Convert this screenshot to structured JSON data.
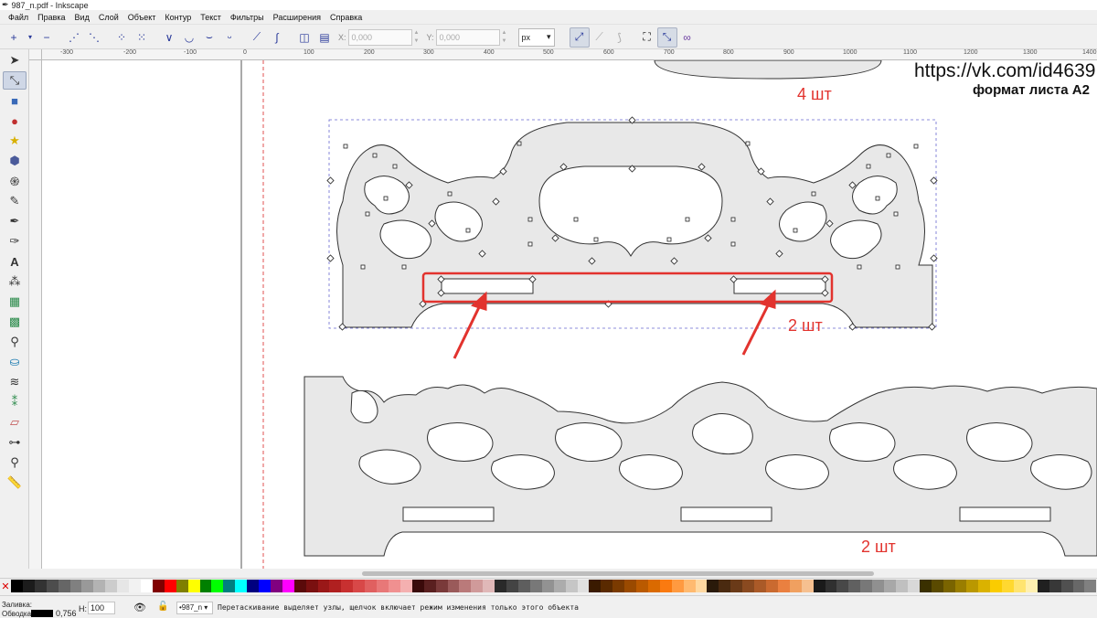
{
  "window": {
    "title": "987_n.pdf - Inkscape"
  },
  "menu": [
    "Файл",
    "Правка",
    "Вид",
    "Слой",
    "Объект",
    "Контур",
    "Текст",
    "Фильтры",
    "Расширения",
    "Справка"
  ],
  "toolbar": {
    "x_label": "X:",
    "x_value": "0,000",
    "y_label": "Y:",
    "y_value": "0,000",
    "unit": "px"
  },
  "ruler": {
    "labels": [
      "-300",
      "-200",
      "-100",
      "0",
      "100",
      "200",
      "300",
      "400",
      "500",
      "600",
      "700",
      "800",
      "900",
      "1000",
      "1100",
      "1200",
      "1300",
      "1400"
    ]
  },
  "canvas": {
    "url_text": "https://vk.com/id4639",
    "sheet_format": "формат листа А2",
    "qty_top": "4 шт",
    "qty_middle": "2 шт",
    "qty_bottom": "2 шт",
    "accent_color": "#e2332e",
    "shape_fill": "#e8e8e8",
    "shape_stroke": "#333333"
  },
  "palette": {
    "colors": [
      "#000000",
      "#1c1c1c",
      "#333333",
      "#4d4d4d",
      "#666666",
      "#808080",
      "#999999",
      "#b3b3b3",
      "#cccccc",
      "#e6e6e6",
      "#f2f2f2",
      "#ffffff",
      "#800000",
      "#ff0000",
      "#808000",
      "#ffff00",
      "#008000",
      "#00ff00",
      "#008080",
      "#00ffff",
      "#000080",
      "#0000ff",
      "#800080",
      "#ff00ff",
      "#5a0a0a",
      "#7a1010",
      "#9a1818",
      "#b02020",
      "#c83030",
      "#d84848",
      "#e06060",
      "#e87878",
      "#f09090",
      "#f4b0b0",
      "#3a0a0a",
      "#5a2020",
      "#7a3a3a",
      "#9a5a5a",
      "#ba7a7a",
      "#d09a9a",
      "#e0b8b8",
      "#2a2a2a",
      "#444444",
      "#5e5e5e",
      "#787878",
      "#929292",
      "#acacac",
      "#c6c6c6",
      "#e0e0e0",
      "#3a1a00",
      "#5a2a00",
      "#7a3a00",
      "#9a4a00",
      "#ba5a00",
      "#da6a00",
      "#fa7a10",
      "#ff9a40",
      "#ffba70",
      "#ffd8a0",
      "#2a1a0a",
      "#4a2a10",
      "#6a3a18",
      "#8a4a20",
      "#aa5a28",
      "#ca6a30",
      "#ea8040",
      "#f0a060",
      "#f6c090",
      "#1a1a1a",
      "#303030",
      "#484848",
      "#606060",
      "#787878",
      "#909090",
      "#a8a8a8",
      "#c0c0c0",
      "#d8d8d8",
      "#3a3000",
      "#5a4a00",
      "#7a6400",
      "#9a7e00",
      "#ba9800",
      "#dab200",
      "#facc00",
      "#ffd830",
      "#ffe470",
      "#fff0b0",
      "#202020",
      "#383838",
      "#505050",
      "#686868",
      "#808080"
    ]
  },
  "status": {
    "fill_label": "Заливка:",
    "stroke_label": "Обводка:",
    "stroke_width": "0,756",
    "opacity_label": "Н:",
    "opacity_value": "100",
    "layer": "•987_n",
    "message": "Перетаскивание выделяет узлы, щелчок включает режим изменения только этого объекта"
  }
}
